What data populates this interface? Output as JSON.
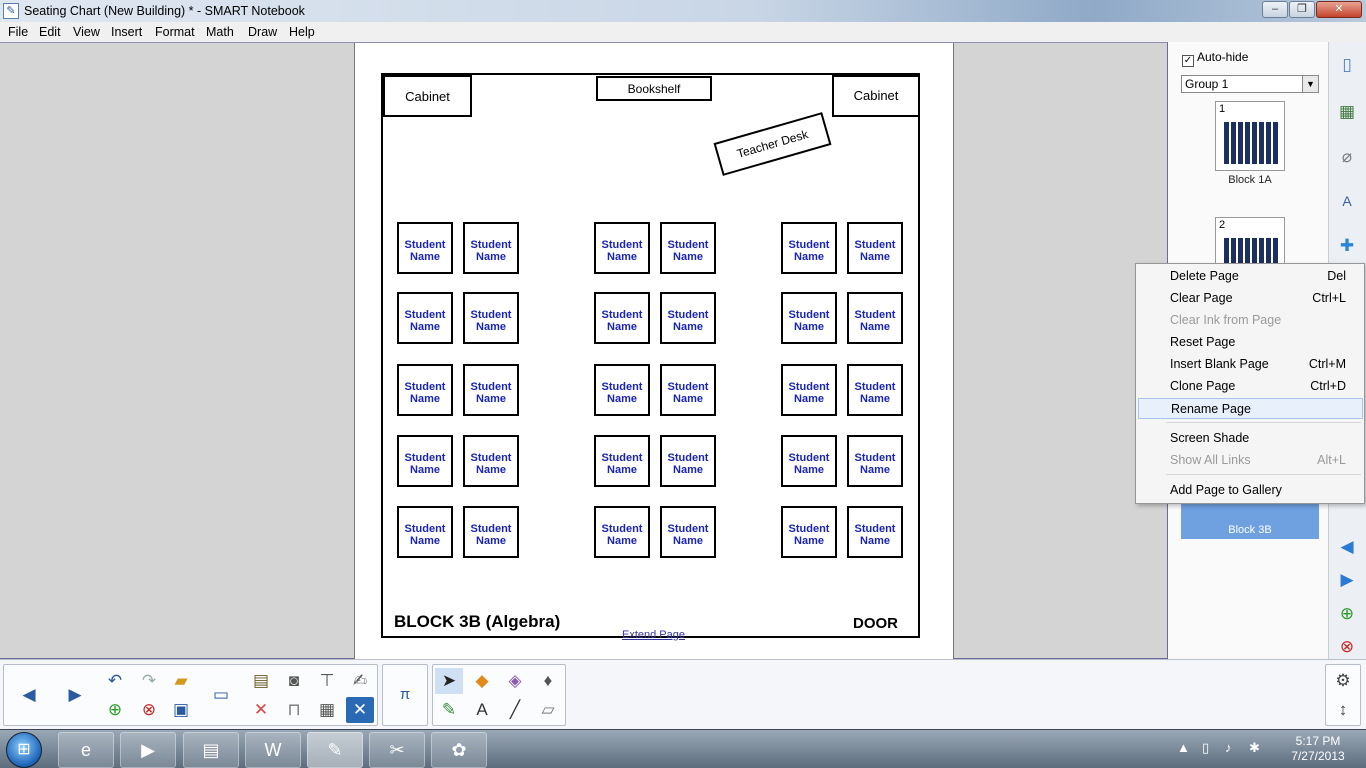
{
  "window": {
    "title": "Seating Chart (New Building) * - SMART Notebook",
    "app_icon": "notebook-icon"
  },
  "menu": [
    "File",
    "Edit",
    "View",
    "Insert",
    "Format",
    "Math",
    "Draw",
    "Help"
  ],
  "page": {
    "cabinet_left": "Cabinet",
    "bookshelf": "Bookshelf",
    "cabinet_right": "Cabinet",
    "teacher_desk": "Teacher Desk",
    "desk_label_line1": "Student",
    "desk_label_line2": "Name",
    "block_label": "BLOCK 3B (Algebra)",
    "door_label": "DOOR",
    "extend_link": "Extend Page"
  },
  "sidebar": {
    "autohide_label": "Auto-hide",
    "autohide_checked": "✓",
    "group_value": "Group 1",
    "thumbnails": [
      {
        "number": "1",
        "label": "Block 1A"
      },
      {
        "number": "2",
        "label": ""
      },
      {
        "number": "",
        "label": "Block 3B"
      }
    ]
  },
  "context_menu": [
    {
      "label": "Delete Page",
      "shortcut": "Del",
      "enabled": true
    },
    {
      "label": "Clear Page",
      "shortcut": "Ctrl+L",
      "enabled": true
    },
    {
      "label": "Clear Ink from Page",
      "shortcut": "",
      "enabled": false
    },
    {
      "label": "Reset Page",
      "shortcut": "",
      "enabled": true
    },
    {
      "label": "Insert Blank Page",
      "shortcut": "Ctrl+M",
      "enabled": true
    },
    {
      "label": "Clone Page",
      "shortcut": "Ctrl+D",
      "enabled": true
    },
    {
      "label": "Rename Page",
      "shortcut": "",
      "enabled": true,
      "highlighted": true
    },
    {
      "label": "Screen Shade",
      "shortcut": "",
      "enabled": true
    },
    {
      "label": "Show All Links",
      "shortcut": "Alt+L",
      "enabled": false
    },
    {
      "label": "Add Page to Gallery",
      "shortcut": "",
      "enabled": true
    }
  ],
  "taskbar": {
    "time": "5:17 PM",
    "date": "7/27/2013",
    "apps": [
      "internet-explorer-icon",
      "media-player-icon",
      "file-explorer-icon",
      "word-icon",
      "smart-notebook-icon",
      "snipping-tool-icon",
      "paint-icon"
    ]
  }
}
